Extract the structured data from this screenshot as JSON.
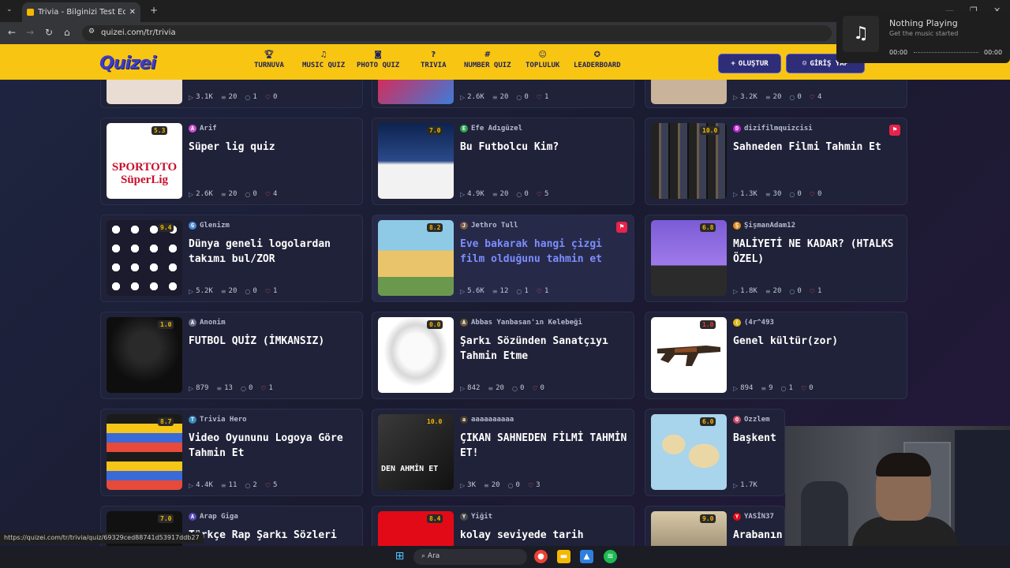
{
  "browser": {
    "tab_title": "Trivia - Bilginizi Test Edin - Quiz",
    "url": "quizei.com/tr/trivia",
    "status_url": "https://quizei.com/tr/trivia/quiz/69329ced88741d53917ddb27"
  },
  "site": {
    "logo": "Quizei",
    "menu": [
      {
        "label": "TURNUVA",
        "icon": "trophy-icon"
      },
      {
        "label": "MUSIC QUIZ",
        "icon": "music-icon"
      },
      {
        "label": "PHOTO QUIZ",
        "icon": "camera-icon"
      },
      {
        "label": "TRIVIA",
        "icon": "question-icon"
      },
      {
        "label": "NUMBER QUIZ",
        "icon": "hash-icon"
      },
      {
        "label": "TOPLULUK",
        "icon": "users-icon"
      },
      {
        "label": "LEADERBOARD",
        "icon": "medal-icon"
      }
    ],
    "create_label": "OLUŞTUR",
    "login_label": "GİRİŞ YAP"
  },
  "music_widget": {
    "title": "Nothing Playing",
    "subtitle": "Get the music started",
    "time_start": "00:00",
    "time_end": "00:00"
  },
  "top_row_stats": [
    {
      "views": "3.1K",
      "questions": "20",
      "comments": "1",
      "likes": "0"
    },
    {
      "views": "2.6K",
      "questions": "20",
      "comments": "0",
      "likes": "1"
    },
    {
      "views": "3.2K",
      "questions": "20",
      "comments": "0",
      "likes": "4"
    }
  ],
  "cards": [
    {
      "author": "Arif",
      "title": "Süper lig quiz",
      "rating": "5.3",
      "views": "2.6K",
      "questions": "20",
      "comments": "0",
      "likes": "4",
      "thumb_text": "SPORTOTO SüperLig"
    },
    {
      "author": "Efe Adıgüzel",
      "title": "Bu Futbolcu Kim?",
      "rating": "7.0",
      "views": "4.9K",
      "questions": "20",
      "comments": "0",
      "likes": "5"
    },
    {
      "author": "dizifilmquizcisi",
      "title": "Sahneden Filmi Tahmin Et",
      "rating": "10.0",
      "views": "1.3K",
      "questions": "30",
      "comments": "0",
      "likes": "0"
    },
    {
      "author": "Glenizm",
      "title": "Dünya geneli logolardan takımı bul/ZOR",
      "rating": "9.4",
      "views": "5.2K",
      "questions": "20",
      "comments": "0",
      "likes": "1"
    },
    {
      "author": "Jethro Tull",
      "title": "Eve bakarak hangi çizgi film olduğunu tahmin et",
      "rating": "8.2",
      "views": "5.6K",
      "questions": "12",
      "comments": "1",
      "likes": "1"
    },
    {
      "author": "ŞişmanAdam12",
      "title": "MALİYETİ NE KADAR? (HTALKS ÖZEL)",
      "rating": "6.8",
      "views": "1.8K",
      "questions": "20",
      "comments": "0",
      "likes": "1"
    },
    {
      "author": "Anonim",
      "title": "FUTBOL QUİZ (İMKANSIZ)",
      "rating": "1.0",
      "views": "879",
      "questions": "13",
      "comments": "0",
      "likes": "1"
    },
    {
      "author": "Abbas Yanbasan'ın Kelebeği",
      "title": "Şarkı Sözünden Sanatçıyı Tahmin Etme",
      "rating": "0.0",
      "views": "842",
      "questions": "20",
      "comments": "0",
      "likes": "0"
    },
    {
      "author": "(4r^493",
      "title": "Genel kültür(zor)",
      "rating": "1.0",
      "views": "894",
      "questions": "9",
      "comments": "1",
      "likes": "0"
    },
    {
      "author": "Trivia Hero",
      "title": "Video Oyununu Logoya Göre Tahmin Et",
      "rating": "8.7",
      "views": "4.4K",
      "questions": "11",
      "comments": "2",
      "likes": "5"
    },
    {
      "author": "aaaaaaaaaa",
      "title": "ÇIKAN SAHNEDEN FİLMİ TAHMİN ET!",
      "rating": "10.0",
      "views": "3K",
      "questions": "20",
      "comments": "0",
      "likes": "3",
      "thumb_text": "DEN AHMİN ET"
    },
    {
      "author": "Ozzlem",
      "title": "Başkent",
      "rating": "6.0",
      "views": "1.7K",
      "questions": "",
      "comments": "",
      "likes": ""
    },
    {
      "author": "Arap Giga",
      "title": "Türkçe Rap Şarkı Sözleri",
      "rating": "7.0"
    },
    {
      "author": "Yiğit",
      "title": "kolay seviyede tarih",
      "rating": "8.4"
    },
    {
      "author": "YASİN37",
      "title": "Arabanın",
      "rating": "9.0"
    }
  ],
  "taskbar": {
    "search_placeholder": "Ara"
  }
}
